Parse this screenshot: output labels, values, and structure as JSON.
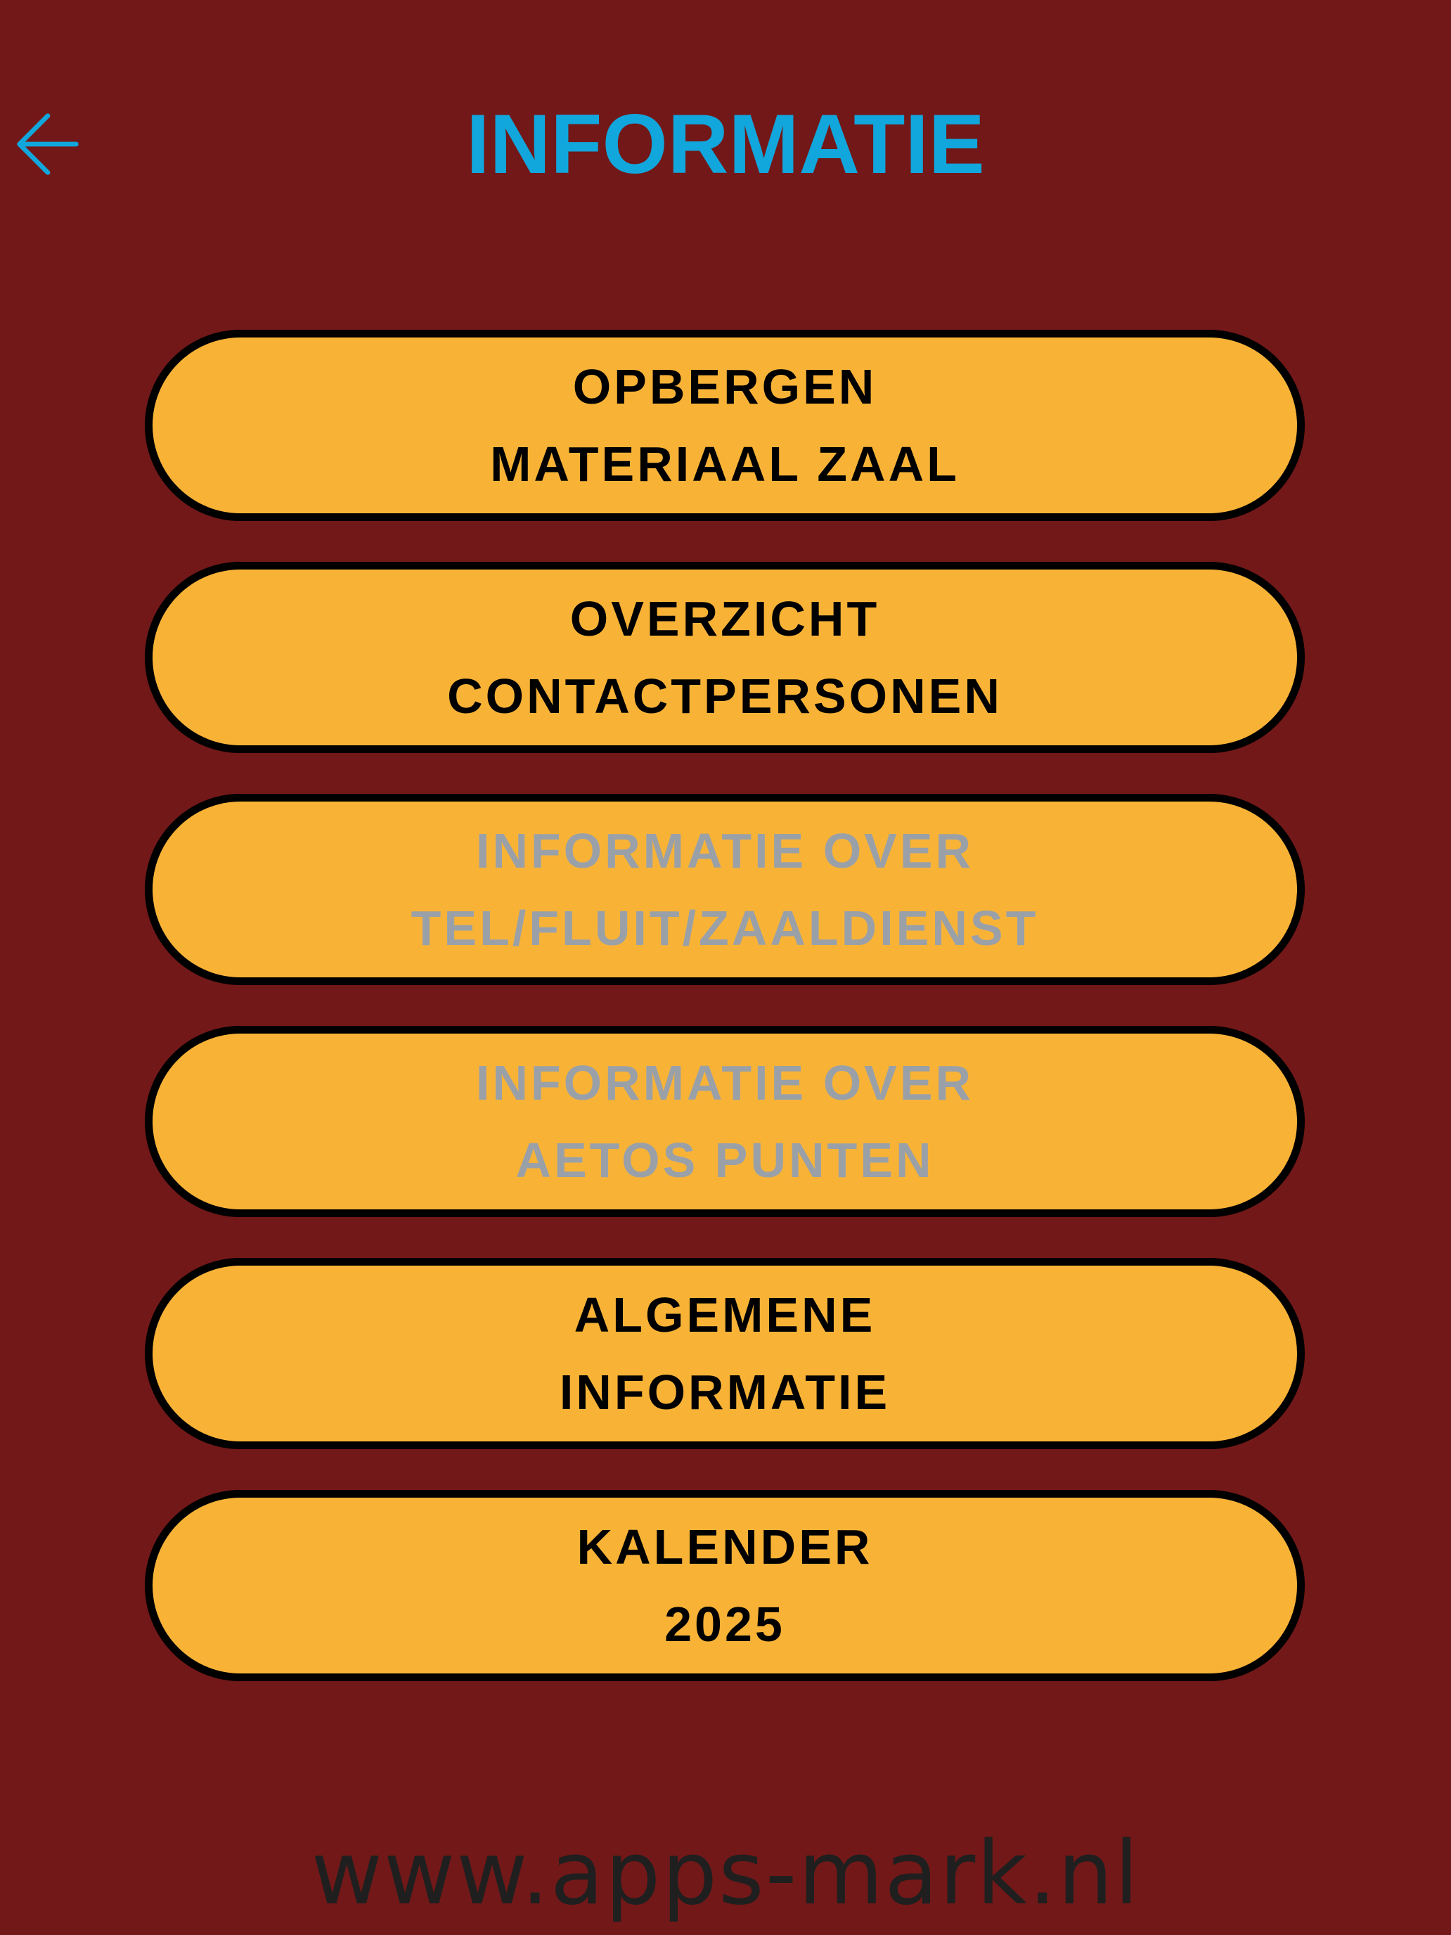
{
  "header": {
    "back_icon": "arrow-left-icon",
    "title": "INFORMATIE"
  },
  "colors": {
    "background": "#721818",
    "title": "#11a6dc",
    "button_fill": "#f8b337",
    "button_border": "#000000",
    "button_text": "#000000",
    "button_text_disabled": "#9aa0a8"
  },
  "menu": {
    "items": [
      {
        "line1": "OPBERGEN",
        "line2": "MATERIAAL ZAAL",
        "enabled": true
      },
      {
        "line1": "OVERZICHT",
        "line2": "CONTACTPERSONEN",
        "enabled": true
      },
      {
        "line1": "INFORMATIE OVER",
        "line2": "TEL/FLUIT/ZAALDIENST",
        "enabled": false
      },
      {
        "line1": "INFORMATIE OVER",
        "line2": "AETOS PUNTEN",
        "enabled": false
      },
      {
        "line1": "ALGEMENE",
        "line2": "INFORMATIE",
        "enabled": true
      },
      {
        "line1": "KALENDER",
        "line2": "2025",
        "enabled": true
      }
    ]
  },
  "footer": {
    "url": "www.apps-mark.nl"
  }
}
